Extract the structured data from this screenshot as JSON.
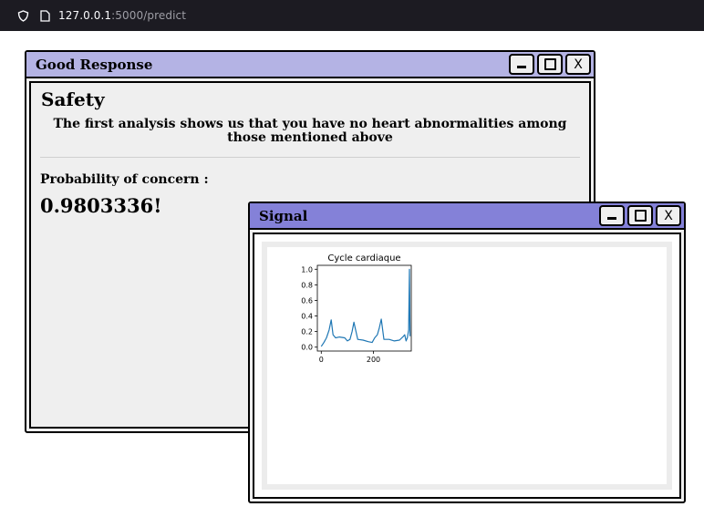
{
  "browser": {
    "url_host": "127.0.0.1",
    "url_rest": ":5000/predict",
    "icons": [
      "shield-icon",
      "page-icon"
    ]
  },
  "window_result": {
    "title": "Good Response",
    "controls": {
      "minimize": "",
      "maximize": "",
      "close": "X"
    },
    "heading": "Safety",
    "message": "The first analysis shows us that you have no heart abnormalities among those mentioned above",
    "probability_label": "Probability of concern :",
    "probability_value": "0.9803336!",
    "title_color": "#b4b3e4"
  },
  "window_signal": {
    "title": "Signal",
    "controls": {
      "minimize": "",
      "maximize": "",
      "close": "X"
    },
    "title_color": "#8481d8"
  },
  "chart_data": {
    "type": "line",
    "title": "Cycle cardiaque",
    "xlabel": "",
    "ylabel": "",
    "xlim": [
      -15,
      345
    ],
    "ylim": [
      -0.05,
      1.05
    ],
    "xticks": [
      0,
      200
    ],
    "yticks": [
      0.0,
      0.2,
      0.4,
      0.6,
      0.8,
      1.0
    ],
    "ytick_labels": [
      "0.0",
      "0.2",
      "0.4",
      "0.6",
      "0.8",
      "1.0"
    ],
    "grid": false,
    "line_color": "#1f77b4",
    "series": [
      {
        "x": [
          0,
          10,
          20,
          30,
          38,
          45,
          55,
          70,
          90,
          100,
          110,
          118,
          125,
          140,
          160,
          180,
          195,
          205,
          215,
          222,
          230,
          240,
          260,
          280,
          300,
          315,
          320,
          325,
          330,
          335,
          338,
          340
        ],
        "values": [
          0.01,
          0.06,
          0.12,
          0.22,
          0.35,
          0.16,
          0.12,
          0.13,
          0.12,
          0.08,
          0.1,
          0.2,
          0.32,
          0.1,
          0.09,
          0.07,
          0.06,
          0.12,
          0.16,
          0.24,
          0.36,
          0.1,
          0.1,
          0.08,
          0.09,
          0.14,
          0.16,
          0.08,
          0.12,
          0.22,
          1.0,
          0.14
        ]
      }
    ]
  }
}
